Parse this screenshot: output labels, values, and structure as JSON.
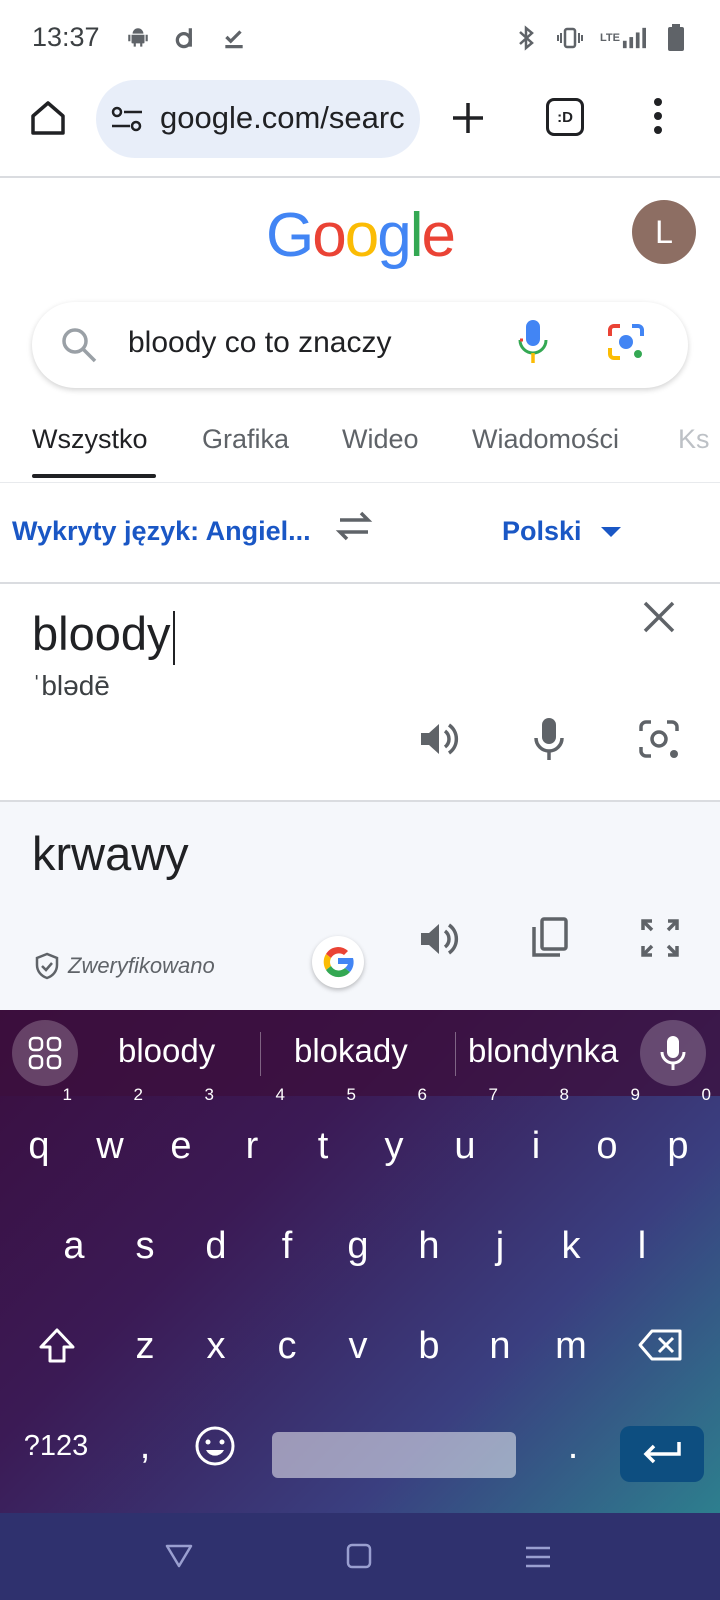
{
  "status_bar": {
    "time": "13:37",
    "network_label": "LTE",
    "left_icons": [
      "android-icon",
      "d-app-icon",
      "download-done-icon"
    ],
    "right_icons": [
      "bluetooth-icon",
      "vibrate-icon",
      "signal-icon",
      "battery-icon"
    ]
  },
  "browser": {
    "url": "google.com/search",
    "tab_count_label": ":D",
    "icons": [
      "home-icon",
      "site-settings-icon",
      "new-tab-icon",
      "tab-switcher-icon",
      "more-menu-icon"
    ]
  },
  "google": {
    "logo_letters": [
      "G",
      "o",
      "o",
      "g",
      "l",
      "e"
    ],
    "logo_colors": [
      "#4285F4",
      "#EA4335",
      "#FBBC05",
      "#4285F4",
      "#34A853",
      "#EA4335"
    ],
    "avatar_initial": "L",
    "avatar_color": "#8d6e63",
    "search_query": "bloody co to znaczy"
  },
  "tabs": [
    {
      "label": "Wszystko",
      "active": true
    },
    {
      "label": "Grafika",
      "active": false
    },
    {
      "label": "Wideo",
      "active": false
    },
    {
      "label": "Wiadomości",
      "active": false
    },
    {
      "label": "Ks",
      "active": false
    }
  ],
  "translator": {
    "source_language": "Wykryty język: Angiel...",
    "target_language": "Polski",
    "source_text": "bloody",
    "phonetic": "ˈblədē",
    "translation": "krwawy",
    "verified_label": "Zweryfikowano",
    "accent_color": "#1a57c5"
  },
  "keyboard": {
    "suggestions": [
      "bloody",
      "blokady",
      "blondynka"
    ],
    "row1": [
      {
        "key": "q",
        "hint": "1"
      },
      {
        "key": "w",
        "hint": "2"
      },
      {
        "key": "e",
        "hint": "3"
      },
      {
        "key": "r",
        "hint": "4"
      },
      {
        "key": "t",
        "hint": "5"
      },
      {
        "key": "y",
        "hint": "6"
      },
      {
        "key": "u",
        "hint": "7"
      },
      {
        "key": "i",
        "hint": "8"
      },
      {
        "key": "o",
        "hint": "9"
      },
      {
        "key": "p",
        "hint": "0"
      }
    ],
    "row2": [
      "a",
      "s",
      "d",
      "f",
      "g",
      "h",
      "j",
      "k",
      "l"
    ],
    "row3": [
      "z",
      "x",
      "c",
      "v",
      "b",
      "n",
      "m"
    ],
    "symbols_label": "?123",
    "comma_label": ",",
    "period_label": "."
  }
}
